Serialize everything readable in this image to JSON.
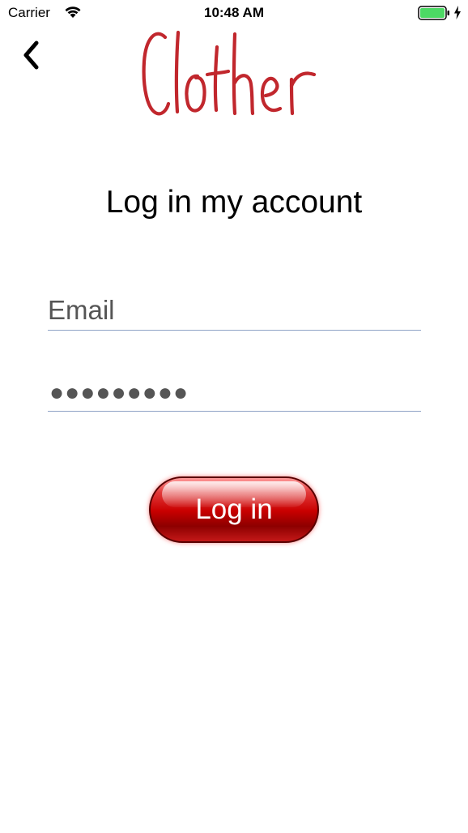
{
  "status_bar": {
    "carrier": "Carrier",
    "time": "10:48 AM",
    "battery_color": "#4cd964"
  },
  "nav": {
    "back_icon": "chevron-left-icon",
    "logo_text": "Clother",
    "logo_color": "#c1272d"
  },
  "page": {
    "title": "Log in my account"
  },
  "form": {
    "email_placeholder": "Email",
    "email_value": "",
    "password_value": "●●●●●●●●●"
  },
  "login_button": {
    "label": "Log in",
    "color": "#c90000"
  }
}
